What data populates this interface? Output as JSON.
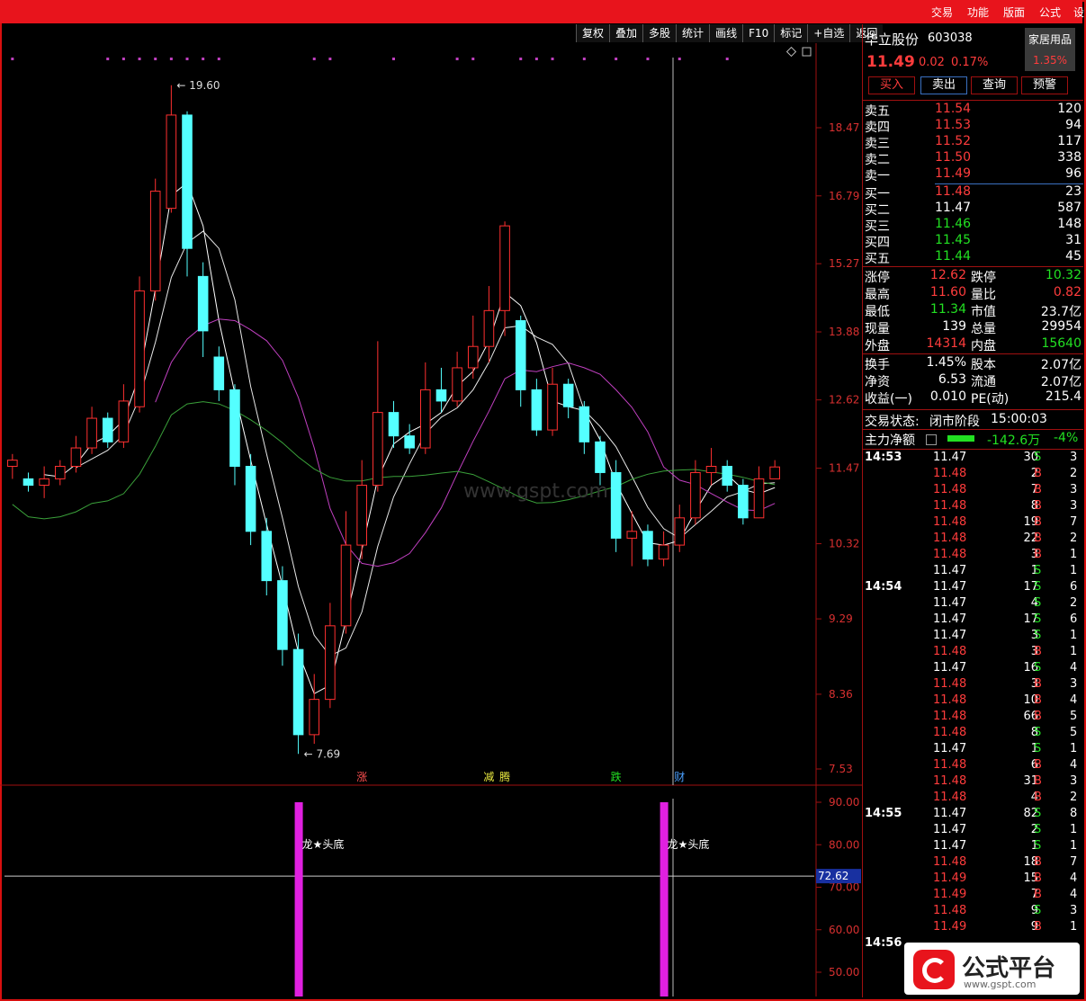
{
  "menu": [
    "交易",
    "功能",
    "版面",
    "公式",
    "设"
  ],
  "toolbar": [
    "复权",
    "叠加",
    "多股",
    "统计",
    "画线",
    "F10",
    "标记",
    "+自选",
    "返回"
  ],
  "stock": {
    "name": "华立股份",
    "code": "603038",
    "sector": "家居用品",
    "sector_pct": "1.35%",
    "price": "11.49",
    "change": "0.02",
    "pct": "0.17%"
  },
  "actions": [
    "买入",
    "卖出",
    "查询",
    "预警"
  ],
  "asks": [
    {
      "label": "卖五",
      "price": "11.54",
      "vol": "120"
    },
    {
      "label": "卖四",
      "price": "11.53",
      "vol": "94"
    },
    {
      "label": "卖三",
      "price": "11.52",
      "vol": "117"
    },
    {
      "label": "卖二",
      "price": "11.50",
      "vol": "338"
    },
    {
      "label": "卖一",
      "price": "11.49",
      "vol": "96"
    }
  ],
  "bids": [
    {
      "label": "买一",
      "price": "11.48",
      "vol": "23"
    },
    {
      "label": "买二",
      "price": "11.47",
      "vol": "587"
    },
    {
      "label": "买三",
      "price": "11.46",
      "vol": "148"
    },
    {
      "label": "买四",
      "price": "11.45",
      "vol": "31"
    },
    {
      "label": "买五",
      "price": "11.44",
      "vol": "45"
    }
  ],
  "stats": [
    {
      "l1": "涨停",
      "v1": "12.62",
      "c1": "red",
      "l2": "跌停",
      "v2": "10.32",
      "c2": "green"
    },
    {
      "l1": "最高",
      "v1": "11.60",
      "c1": "red",
      "l2": "量比",
      "v2": "0.82",
      "c2": "red"
    },
    {
      "l1": "最低",
      "v1": "11.34",
      "c1": "green",
      "l2": "市值",
      "v2": "23.7亿",
      "c2": "white"
    },
    {
      "l1": "现量",
      "v1": "139",
      "c1": "white",
      "l2": "总量",
      "v2": "29954",
      "c2": "white"
    },
    {
      "l1": "外盘",
      "v1": "14314",
      "c1": "red",
      "l2": "内盘",
      "v2": "15640",
      "c2": "green"
    }
  ],
  "stats2": [
    {
      "l1": "换手",
      "v1": "1.45%",
      "l2": "股本",
      "v2": "2.07亿"
    },
    {
      "l1": "净资",
      "v1": "6.53",
      "l2": "流通",
      "v2": "2.07亿"
    },
    {
      "l1": "收益(一)",
      "v1": "0.010",
      "l2": "PE(动)",
      "v2": "215.4"
    }
  ],
  "status": {
    "label": "交易状态:",
    "value": "闭市阶段",
    "time": "15:00:03"
  },
  "flow": {
    "label": "主力净额",
    "value": "-142.6万",
    "pct": "-4%"
  },
  "ticks": [
    {
      "t": "14:53",
      "p": "11.47",
      "v": "30",
      "s": "S",
      "n": "3"
    },
    {
      "t": "",
      "p": "11.48",
      "v": "2",
      "s": "B",
      "n": "2"
    },
    {
      "t": "",
      "p": "11.48",
      "v": "7",
      "s": "B",
      "n": "3"
    },
    {
      "t": "",
      "p": "11.48",
      "v": "8",
      "s": "B",
      "n": "3"
    },
    {
      "t": "",
      "p": "11.48",
      "v": "19",
      "s": "B",
      "n": "7"
    },
    {
      "t": "",
      "p": "11.48",
      "v": "22",
      "s": "B",
      "n": "2"
    },
    {
      "t": "",
      "p": "11.48",
      "v": "3",
      "s": "B",
      "n": "1"
    },
    {
      "t": "",
      "p": "11.47",
      "v": "1",
      "s": "S",
      "n": "1"
    },
    {
      "t": "14:54",
      "p": "11.47",
      "v": "17",
      "s": "S",
      "n": "6"
    },
    {
      "t": "",
      "p": "11.47",
      "v": "4",
      "s": "S",
      "n": "2"
    },
    {
      "t": "",
      "p": "11.47",
      "v": "17",
      "s": "S",
      "n": "6"
    },
    {
      "t": "",
      "p": "11.47",
      "v": "3",
      "s": "S",
      "n": "1"
    },
    {
      "t": "",
      "p": "11.48",
      "v": "3",
      "s": "B",
      "n": "1"
    },
    {
      "t": "",
      "p": "11.47",
      "v": "16",
      "s": "S",
      "n": "4"
    },
    {
      "t": "",
      "p": "11.48",
      "v": "3",
      "s": "B",
      "n": "3"
    },
    {
      "t": "",
      "p": "11.48",
      "v": "10",
      "s": "B",
      "n": "4"
    },
    {
      "t": "",
      "p": "11.48",
      "v": "66",
      "s": "B",
      "n": "5"
    },
    {
      "t": "",
      "p": "11.48",
      "v": "8",
      "s": "S",
      "n": "5"
    },
    {
      "t": "",
      "p": "11.47",
      "v": "1",
      "s": "S",
      "n": "1"
    },
    {
      "t": "",
      "p": "11.48",
      "v": "6",
      "s": "B",
      "n": "4"
    },
    {
      "t": "",
      "p": "11.48",
      "v": "31",
      "s": "B",
      "n": "3"
    },
    {
      "t": "",
      "p": "11.48",
      "v": "4",
      "s": "B",
      "n": "2"
    },
    {
      "t": "14:55",
      "p": "11.47",
      "v": "82",
      "s": "S",
      "n": "8"
    },
    {
      "t": "",
      "p": "11.47",
      "v": "2",
      "s": "S",
      "n": "1"
    },
    {
      "t": "",
      "p": "11.47",
      "v": "1",
      "s": "S",
      "n": "1"
    },
    {
      "t": "",
      "p": "11.48",
      "v": "18",
      "s": "B",
      "n": "7"
    },
    {
      "t": "",
      "p": "11.49",
      "v": "15",
      "s": "B",
      "n": "4"
    },
    {
      "t": "",
      "p": "11.49",
      "v": "7",
      "s": "B",
      "n": "4"
    },
    {
      "t": "",
      "p": "11.48",
      "v": "9",
      "s": "S",
      "n": "3"
    },
    {
      "t": "",
      "p": "11.49",
      "v": "9",
      "s": "B",
      "n": "1"
    },
    {
      "t": "14:56",
      "p": "",
      "v": "",
      "s": "",
      "n": ""
    }
  ],
  "chart_data": {
    "type": "candlestick",
    "price_ticks": [
      "18.47",
      "16.79",
      "15.27",
      "13.88",
      "12.62",
      "11.47",
      "10.32",
      "9.29",
      "8.36",
      "7.53"
    ],
    "price_ticks_val": [
      18.47,
      16.79,
      15.27,
      13.88,
      12.62,
      11.47,
      10.32,
      9.29,
      8.36,
      7.53
    ],
    "annotations": {
      "high": "19.60",
      "low": "7.69"
    },
    "event_labels": [
      {
        "text": "涨",
        "color": "#ff5050",
        "i": 22
      },
      {
        "text": "减",
        "color": "#e8e840",
        "i": 30
      },
      {
        "text": "腾",
        "color": "#e8e840",
        "i": 31
      },
      {
        "text": "跌",
        "color": "#22e022",
        "i": 38
      },
      {
        "text": "财",
        "color": "#4aa0ff",
        "i": 42
      }
    ],
    "indicator_ticks": [
      "90.00",
      "80.00",
      "70.00",
      "60.00",
      "50.00"
    ],
    "indicator_ticks_val": [
      90,
      80,
      70,
      60,
      50
    ],
    "indicator_value": "72.62",
    "signals": [
      {
        "i": 18,
        "label": "龙★头底"
      },
      {
        "i": 41,
        "label": "龙★头底"
      }
    ],
    "candles": [
      [
        11.5,
        11.6,
        11.7,
        11.3
      ],
      [
        11.3,
        11.2,
        11.4,
        11.1
      ],
      [
        11.2,
        11.3,
        11.5,
        11.0
      ],
      [
        11.3,
        11.5,
        11.6,
        11.2
      ],
      [
        11.5,
        11.8,
        12.0,
        11.4
      ],
      [
        11.8,
        12.3,
        12.5,
        11.7
      ],
      [
        12.3,
        11.9,
        12.4,
        11.8
      ],
      [
        11.9,
        12.6,
        12.9,
        11.8
      ],
      [
        12.5,
        14.7,
        15.0,
        12.4
      ],
      [
        14.7,
        16.9,
        17.2,
        14.5
      ],
      [
        16.5,
        18.8,
        19.6,
        16.4
      ],
      [
        18.8,
        15.6,
        18.9,
        15.0
      ],
      [
        15.0,
        13.9,
        15.3,
        13.4
      ],
      [
        13.4,
        12.8,
        13.6,
        12.6
      ],
      [
        12.8,
        11.5,
        12.9,
        11.2
      ],
      [
        11.5,
        10.5,
        11.7,
        10.3
      ],
      [
        10.5,
        9.8,
        10.7,
        9.6
      ],
      [
        9.8,
        8.9,
        10.0,
        8.7
      ],
      [
        8.9,
        7.9,
        9.1,
        7.69
      ],
      [
        7.9,
        8.3,
        8.6,
        7.8
      ],
      [
        8.3,
        9.2,
        9.5,
        8.2
      ],
      [
        9.2,
        10.3,
        10.8,
        9.1
      ],
      [
        10.3,
        11.2,
        11.6,
        10.1
      ],
      [
        11.2,
        12.4,
        13.7,
        11.1
      ],
      [
        12.4,
        12.0,
        12.6,
        11.8
      ],
      [
        12.0,
        11.8,
        12.2,
        11.7
      ],
      [
        11.8,
        12.8,
        13.3,
        11.7
      ],
      [
        12.8,
        12.6,
        13.2,
        12.4
      ],
      [
        12.6,
        13.2,
        13.5,
        12.5
      ],
      [
        13.2,
        13.6,
        14.2,
        13.0
      ],
      [
        13.6,
        14.3,
        14.8,
        13.3
      ],
      [
        14.3,
        16.1,
        16.2,
        13.8
      ],
      [
        14.1,
        12.8,
        14.2,
        12.5
      ],
      [
        12.8,
        12.1,
        13.0,
        12.0
      ],
      [
        12.1,
        12.9,
        13.2,
        12.0
      ],
      [
        12.9,
        12.5,
        13.0,
        12.3
      ],
      [
        12.5,
        11.9,
        12.6,
        11.7
      ],
      [
        11.9,
        11.4,
        12.0,
        11.2
      ],
      [
        11.4,
        10.4,
        11.6,
        10.2
      ],
      [
        10.4,
        10.5,
        10.8,
        10.0
      ],
      [
        10.5,
        10.1,
        10.6,
        10.0
      ],
      [
        10.1,
        10.3,
        10.5,
        10.0
      ],
      [
        10.3,
        10.7,
        10.9,
        10.2
      ],
      [
        10.7,
        11.4,
        11.6,
        10.6
      ],
      [
        11.4,
        11.5,
        11.8,
        11.2
      ],
      [
        11.5,
        11.2,
        11.6,
        11.1
      ],
      [
        11.2,
        10.7,
        11.3,
        10.6
      ],
      [
        10.7,
        11.3,
        11.5,
        10.7
      ],
      [
        11.3,
        11.49,
        11.6,
        11.34
      ]
    ]
  }
}
